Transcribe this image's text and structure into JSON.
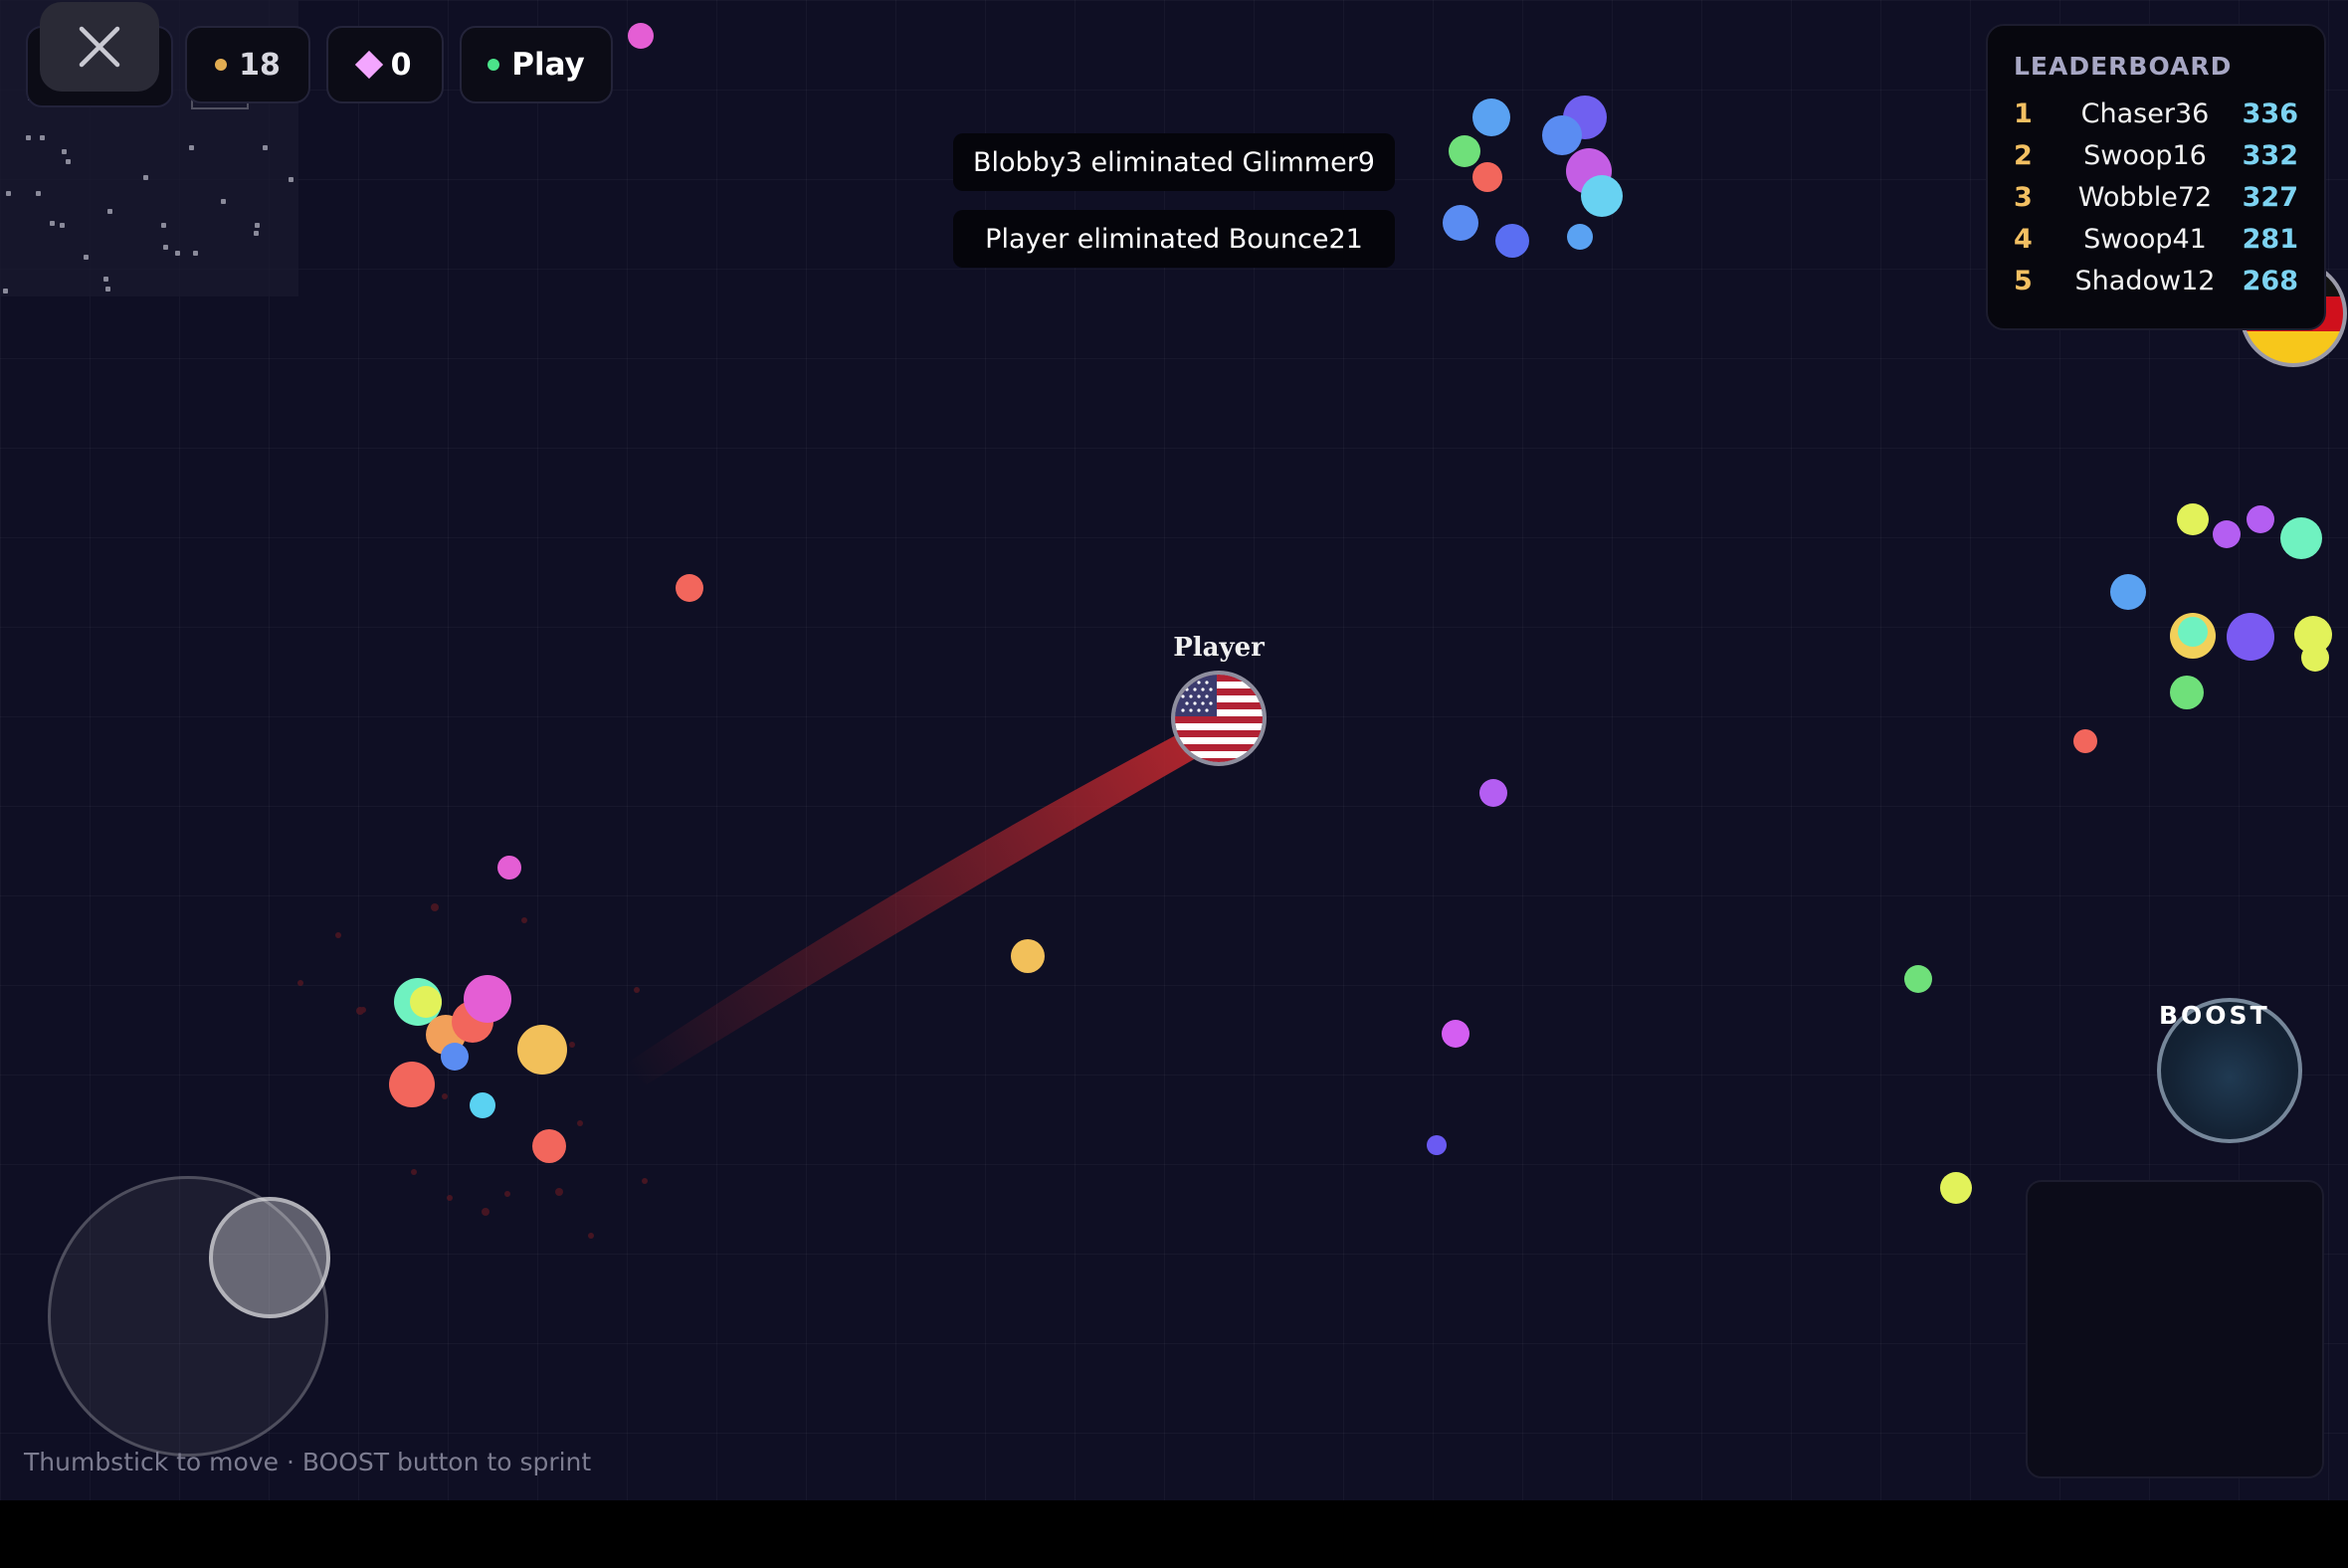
{
  "hud": {
    "coins": "18",
    "gems": "0",
    "play_label": "Play",
    "close_icon": "close-icon"
  },
  "killfeed": [
    {
      "text": "Blobby3 eliminated Glimmer9"
    },
    {
      "text": "Player eliminated Bounce21"
    }
  ],
  "leaderboard": {
    "title": "LEADERBOARD",
    "rows": [
      {
        "rank": "1",
        "name": "Chaser36",
        "score": "336"
      },
      {
        "rank": "2",
        "name": "Swoop16",
        "score": "332"
      },
      {
        "rank": "3",
        "name": "Wobble72",
        "score": "327"
      },
      {
        "rank": "4",
        "name": "Swoop41",
        "score": "281"
      },
      {
        "rank": "5",
        "name": "Shadow12",
        "score": "268"
      }
    ]
  },
  "player": {
    "name": "Player",
    "flag": "us-flag-icon",
    "trail_color": "#c0282f"
  },
  "opponent": {
    "flag": "germany-flag-icon"
  },
  "controls": {
    "boost_label": "BOOST",
    "hint": "Thumbstick to move · BOOST button to sprint"
  },
  "colors": {
    "background": "#0f0f24",
    "accent_score": "#7dd3f2",
    "accent_rank": "#f3c062"
  }
}
